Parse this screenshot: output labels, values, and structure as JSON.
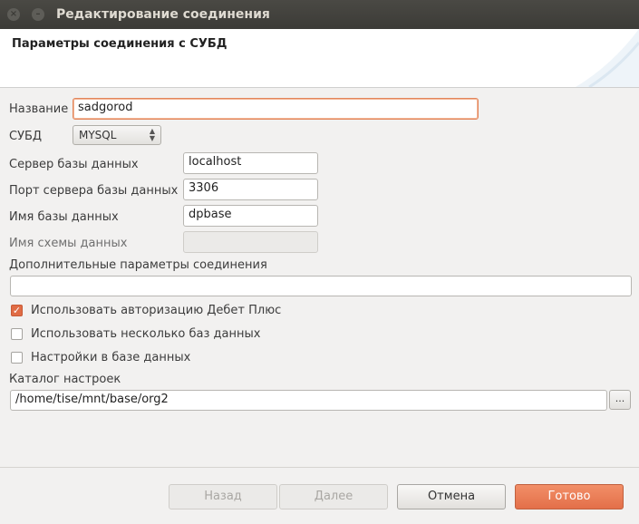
{
  "window": {
    "title": "Редактирование соединения"
  },
  "header": {
    "title": "Параметры соединения с СУБД"
  },
  "form": {
    "name_label": "Название",
    "name_value": "sadgorod",
    "dbms_label": "СУБД",
    "dbms_value": "MYSQL",
    "server_label": "Сервер базы данных",
    "server_value": "localhost",
    "port_label": "Порт сервера базы данных",
    "port_value": "3306",
    "dbname_label": "Имя базы данных",
    "dbname_value": "dpbase",
    "schema_label": "Имя схемы данных",
    "schema_value": "",
    "extra_label": "Дополнительные параметры соединения",
    "extra_value": "",
    "checkboxes": [
      {
        "label": "Использовать авторизацию Дебет Плюс",
        "checked": true
      },
      {
        "label": "Использовать несколько баз данных",
        "checked": false
      },
      {
        "label": "Настройки в базе данных",
        "checked": false
      }
    ],
    "catalog_label": "Каталог настроек",
    "catalog_value": "/home/tise/mnt/base/org2",
    "browse_label": "..."
  },
  "buttons": {
    "back": "Назад",
    "next": "Далее",
    "cancel": "Отмена",
    "finish": "Готово"
  },
  "colors": {
    "accent": "#e36f49",
    "titlebar": "#3c3b37",
    "dialog_bg": "#f2f1f0"
  }
}
